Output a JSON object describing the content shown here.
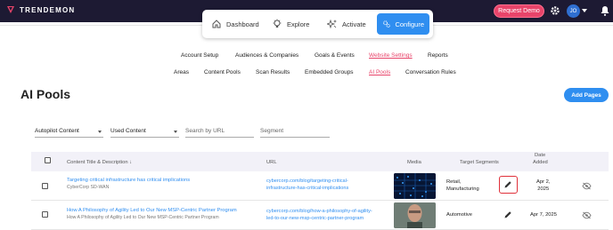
{
  "brand": {
    "name": "TRENDEMON"
  },
  "topbar": {
    "request_demo": "Request Demo",
    "avatar_initials": "JO"
  },
  "main_nav": [
    {
      "label": "Dashboard",
      "icon": "home-icon"
    },
    {
      "label": "Explore",
      "icon": "lightbulb-icon"
    },
    {
      "label": "Activate",
      "icon": "sparkles-icon"
    },
    {
      "label": "Configure",
      "icon": "gears-icon",
      "active": true
    }
  ],
  "sub_nav_1": [
    "Account Setup",
    "Audiences & Companies",
    "Goals & Events",
    "Website Settings",
    "Reports"
  ],
  "sub_nav_2": [
    "Areas",
    "Content Pools",
    "Scan Results",
    "Embedded Groups",
    "AI Pools",
    "Conversation Rules"
  ],
  "page": {
    "title": "AI Pools",
    "add_button": "Add Pages"
  },
  "filters": {
    "pool_select": "Autopilot Content",
    "content_select": "Used Content",
    "search_placeholder": "Search by URL",
    "segment_placeholder": "Segment"
  },
  "table": {
    "headers": {
      "title": "Content Title & Description",
      "url": "URL",
      "media": "Media",
      "segments": "Target Segments",
      "date_line1": "Date",
      "date_line2": "Added"
    },
    "rows": [
      {
        "title": "Targeting critical infrastructure has critical implications",
        "description": "CyberCorp SD-WAN",
        "url_line1": "cybercorp.com/blog/targeting-critical-",
        "url_line2": "infrastructure-has-critical-implications",
        "segments_line1": "Retail,",
        "segments_line2": "Manufacturing",
        "date_line1": "Apr 2,",
        "date_line2": "2025"
      },
      {
        "title": "How A Philosophy of Agility Led to Our New MSP-Centric Partner Program",
        "description": "How A Philosophy of Agility Led to Our New MSP-Centric Partner Program",
        "url_line1": "cybercorp.com/blog/how-a-philosophy-of-agility-",
        "url_line2": "led-to-our-new-msp-centric-partner-program",
        "segments_line1": "Automotive",
        "segments_line2": "",
        "date_line1": "Apr 7, 2025",
        "date_line2": ""
      }
    ]
  },
  "colors": {
    "topbar": "#1d1a33",
    "accent_blue": "#2f8ef0",
    "accent_pink": "#e8446a",
    "highlight_red": "#e0303a"
  }
}
